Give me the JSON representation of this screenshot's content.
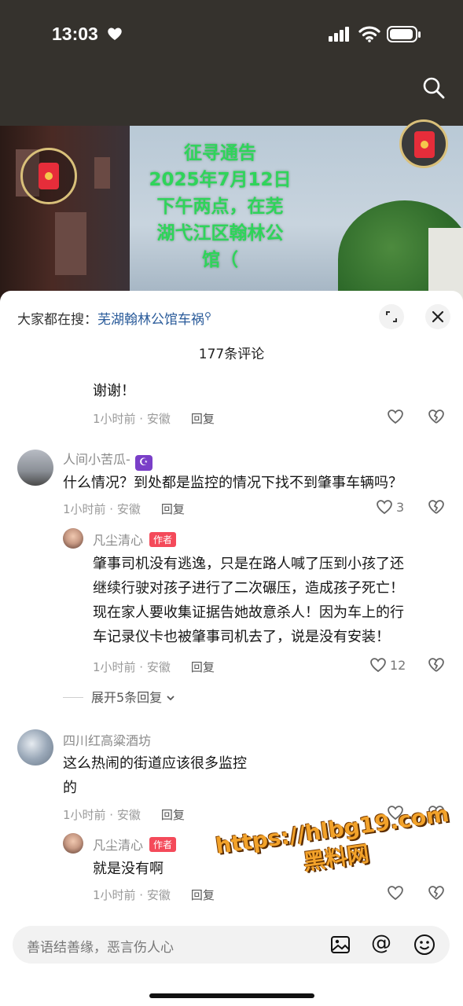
{
  "status_bar": {
    "time": "13:03"
  },
  "video": {
    "notice_lines": [
      "征寻通告",
      "2025年7月12日",
      "下午两点，在芜",
      "湖弋江区翰林公",
      "馆（"
    ]
  },
  "sheet": {
    "search_prefix": "大家都在搜：",
    "search_term": "芜湖翰林公馆车祸",
    "comment_count": "177条评论"
  },
  "comments": [
    {
      "text": "谢谢！",
      "meta": "1小时前 · 安徽",
      "reply": "回复"
    },
    {
      "user": "人间小苦瓜-",
      "badge": "☪",
      "text": "什么情况？到处都是监控的情况下找不到肇事车辆吗？",
      "meta": "1小时前 · 安徽",
      "reply": "回复",
      "likes": "3"
    },
    {
      "user": "凡尘清心",
      "badge": "作者",
      "lines": [
        "肇事司机没有逃逸，只是在路人喊了压到小孩了还",
        "继续行驶对孩子进行了二次碾压，造成孩子死亡！",
        "现在家人要收集证据告她故意杀人！因为车上的行",
        "车记录仪卡也被肇事司机去了，说是没有安装！"
      ],
      "meta": "1小时前 · 安徽",
      "reply": "回复",
      "likes": "12"
    },
    {
      "expand": "展开5条回复"
    },
    {
      "user": "四川红高粱酒坊",
      "lines": [
        "这么热闹的街道应该很多监控",
        "的"
      ],
      "meta": "1小时前 · 安徽",
      "reply": "回复"
    },
    {
      "user": "凡尘清心",
      "badge": "作者",
      "text": "就是没有啊",
      "meta": "1小时前 · 安徽",
      "reply": "回复"
    }
  ],
  "watermark": {
    "url": "https://hlbg19.com",
    "name": "黑料网"
  },
  "input": {
    "placeholder": "善语结善缘，恶言伤人心"
  },
  "colors": {
    "accent_green": "#2fd45a",
    "author_badge": "#f44a5a",
    "link": "#2a5b9a",
    "watermark": "#f2a22a"
  }
}
